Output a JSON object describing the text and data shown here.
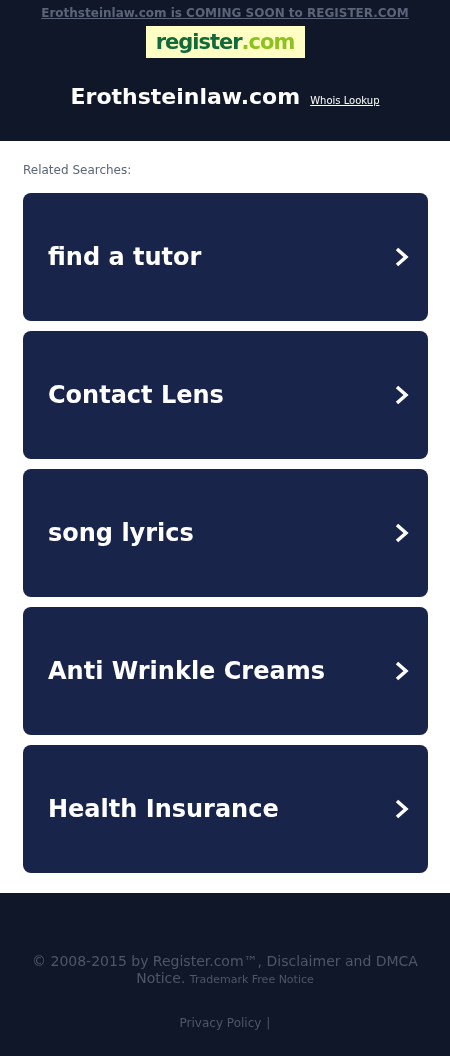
{
  "header": {
    "announcement": "Erothsteinlaw.com is COMING SOON to REGISTER.COM",
    "logo": {
      "name": "register",
      "suffix": ".com"
    },
    "domain": "Erothsteinlaw.com",
    "whois_link": "Whois Lookup"
  },
  "related": {
    "heading": "Related Searches:",
    "items": [
      {
        "label": "find a tutor"
      },
      {
        "label": "Contact Lens"
      },
      {
        "label": "song lyrics"
      },
      {
        "label": "Anti Wrinkle Creams"
      },
      {
        "label": "Health Insurance"
      }
    ]
  },
  "footer": {
    "copyright": "© 2008-2015 by Register.com™, Disclaimer and DMCA Notice.",
    "trademark_link": "Trademark Free Notice",
    "privacy_link": "Privacy Policy",
    "separator": "|"
  }
}
